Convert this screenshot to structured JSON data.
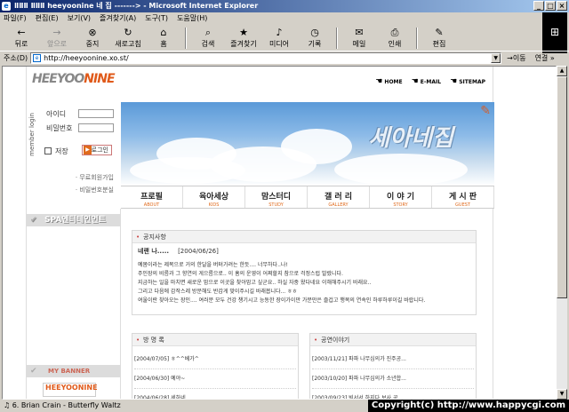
{
  "window": {
    "title": "ⅡⅡⅡ ⅡⅡⅡ heeyoonine 네 집 -------> - Microsoft Internet Explorer"
  },
  "menu": [
    "파일(F)",
    "편집(E)",
    "보기(V)",
    "즐겨찾기(A)",
    "도구(T)",
    "도움말(H)"
  ],
  "toolbar": [
    {
      "label": "뒤로",
      "icon": "back-arrow-icon",
      "glyph": "←",
      "enabled": true
    },
    {
      "label": "앞으로",
      "icon": "forward-arrow-icon",
      "glyph": "→",
      "enabled": false
    },
    {
      "label": "중지",
      "icon": "stop-icon",
      "glyph": "⊗",
      "enabled": true
    },
    {
      "label": "새로고침",
      "icon": "refresh-icon",
      "glyph": "↻",
      "enabled": true
    },
    {
      "label": "홈",
      "icon": "home-icon",
      "glyph": "⌂",
      "enabled": true
    },
    {
      "label": "검색",
      "icon": "search-icon",
      "glyph": "⌕",
      "enabled": true
    },
    {
      "label": "즐겨찾기",
      "icon": "favorites-icon",
      "glyph": "★",
      "enabled": true
    },
    {
      "label": "미디어",
      "icon": "media-icon",
      "glyph": "♪",
      "enabled": true
    },
    {
      "label": "기록",
      "icon": "history-icon",
      "glyph": "◷",
      "enabled": true
    },
    {
      "label": "메일",
      "icon": "mail-icon",
      "glyph": "✉",
      "enabled": true
    },
    {
      "label": "인쇄",
      "icon": "print-icon",
      "glyph": "⎙",
      "enabled": true
    },
    {
      "label": "편집",
      "icon": "edit-icon",
      "glyph": "✎",
      "enabled": true
    }
  ],
  "address": {
    "label": "주소(D)",
    "url": "http://heeyoonine.xo.st/",
    "go": "이동",
    "links": "연결 »"
  },
  "status": {
    "text": "♫ 6. Brian Crain - Butterfly Waltz",
    "copyright": "Copyright(c) http://www.happycgi.com"
  },
  "site": {
    "logo_main": "HEEYOO",
    "logo_accent": "NINE",
    "toplinks": [
      "HOME",
      "E-MAIL",
      "SITEMAP"
    ],
    "hero_title": "세아네집",
    "login": {
      "vertical": "member login",
      "id_label": "아이디",
      "pw_label": "비밀번호",
      "save_label": "저장",
      "button": "로그인",
      "links": [
        "· 무료회원가입",
        "· 비밀번호분실"
      ]
    },
    "nav": [
      {
        "k": "프로필",
        "e": "ABOUT"
      },
      {
        "k": "육아세상",
        "e": "KIDS"
      },
      {
        "k": "맘스터디",
        "e": "STUDY"
      },
      {
        "k": "갤 러 리",
        "e": "GALLERY"
      },
      {
        "k": "이 야 기",
        "e": "STORY"
      },
      {
        "k": "게 시 판",
        "e": "GUEST"
      }
    ],
    "spa": "SPA엔터테인먼트",
    "mybanner": "MY BANNER",
    "banner_logo": "HEEYOONINE",
    "notice": {
      "title": "공지사항",
      "author": "네랜 나.....",
      "date": "[2004/06/26]",
      "body": "예봄이라는 제목으로 거의 한달을 버텨가려는 한듯.... 너무하다..나!\n주인장의 비름과 그 향연의 게으름으로.. 이 홈의 운영이 어쩌할지 참으로 걱정스럽 발랐니다.\n지금하는 일을 마치면 새로운 맘으로 이곳을 찾아맘고 싶군요.. 하실 자중 왔다네요 이해해주시기 바래요..\n그리고 다음에 감작스레 방문해도 반갑게 맞이주시길 바래봅니다... ㅎㅎ\n여울이란 찾아오는 장인.... 여러분 모두 건강 챙기시고 능동한 장이가이만 가분만은 즐겁고 행복의 연속인 하루하루이길 바랍니다."
    },
    "guest": {
      "title": "방 명 록",
      "items": [
        "[2004/07/05] ㅎ^^베가^",
        "[2004/06/30] 예야~",
        "[2004/06/28] 세하네"
      ]
    },
    "concert": {
      "title": "공연이야기",
      "items": [
        "[2003/11/21] 파파 나무심의가 진주공...",
        "[2003/10/20] 파파 나무심의가 소년합...",
        "[2003/09/23] 빅서서 하지다 보사 공"
      ]
    }
  }
}
